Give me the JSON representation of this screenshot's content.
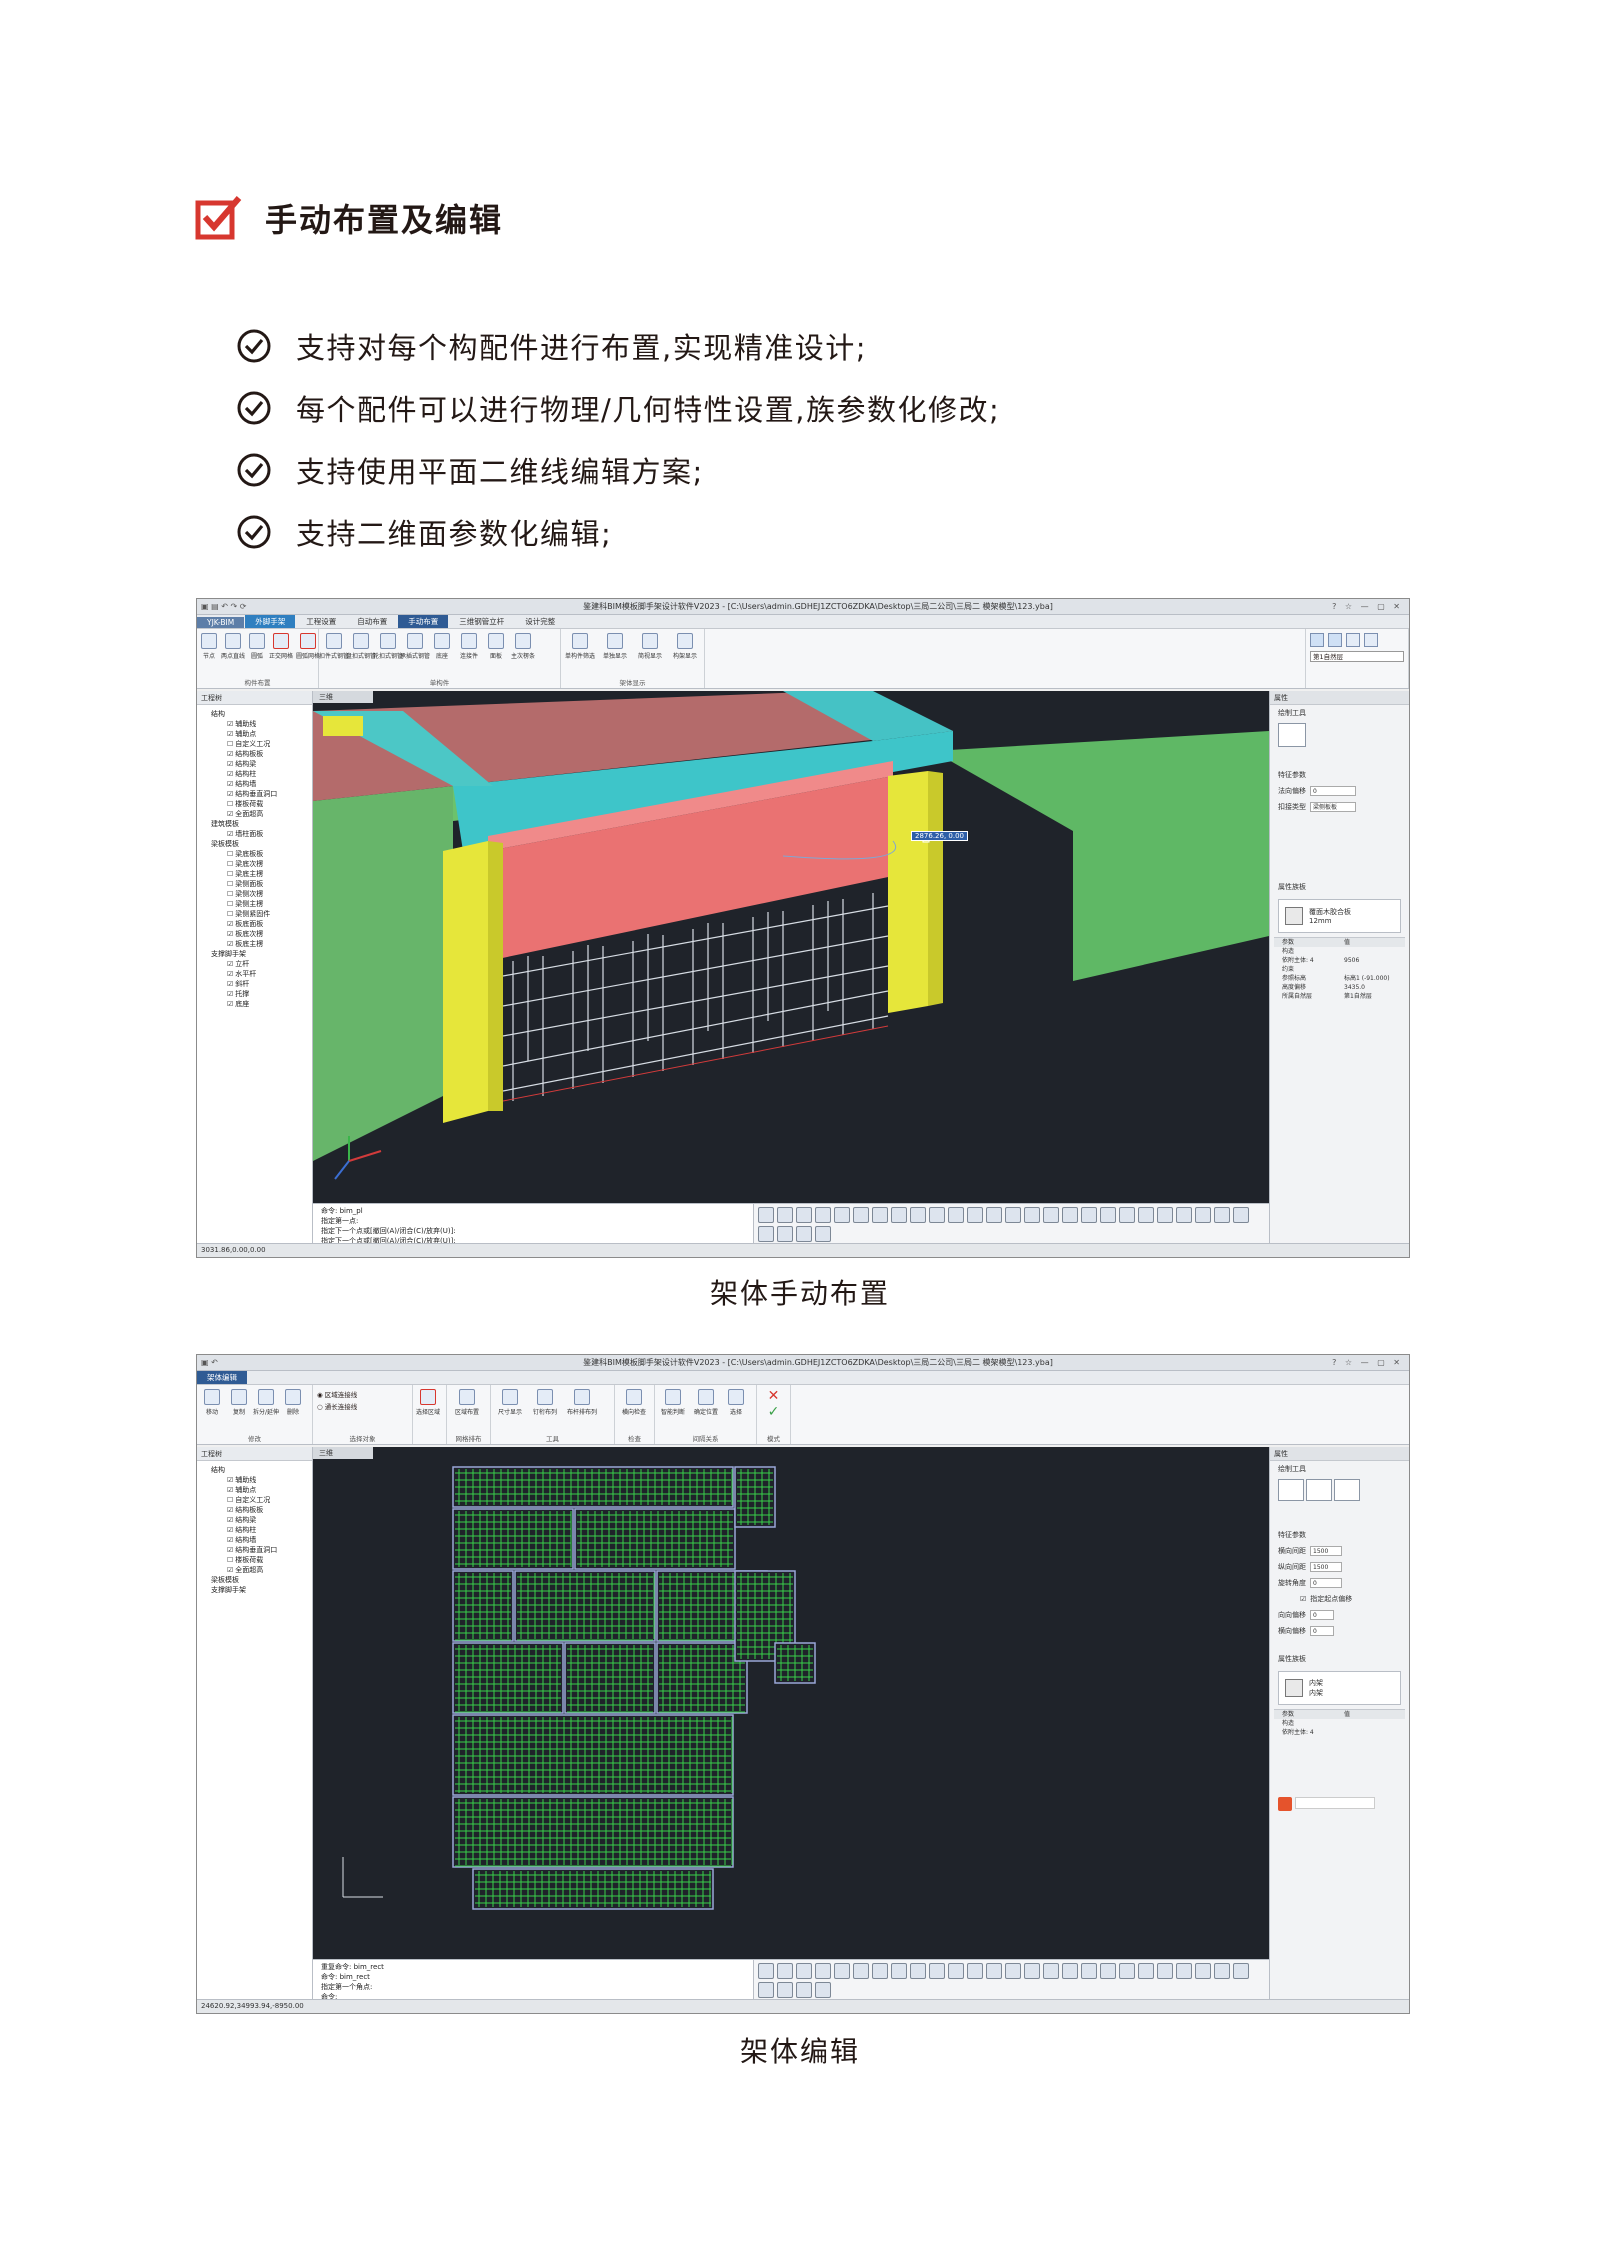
{
  "section": {
    "title": "手动布置及编辑",
    "accent_color": "#d7372f",
    "icon": "checkbox-checked-icon"
  },
  "features": [
    {
      "icon": "check-circle-icon",
      "text": "支持对每个构配件进行布置,实现精准设计;"
    },
    {
      "icon": "check-circle-icon",
      "text": "每个配件可以进行物理/几何特性设置,族参数化修改;"
    },
    {
      "icon": "check-circle-icon",
      "text": "支持使用平面二维线编辑方案;"
    },
    {
      "icon": "check-circle-icon",
      "text": "支持二维面参数化编辑;"
    }
  ],
  "figures": [
    {
      "caption": "架体手动布置",
      "window_title": "鉴建科BIM模板脚手架设计软件V2023 - [C:\\Users\\admin.GDHEJ1ZCTO6ZDKA\\Desktop\\三局二公司\\三局二 模架模型\\123.yba]",
      "tabs": [
        "YJK-BIM",
        "外脚手架",
        "工程设置",
        "自动布置",
        "手动布置",
        "三维钢管立杆",
        "设计完整"
      ],
      "active_tab": "手动布置",
      "ribbon_groups": [
        {
          "name": "构件布置",
          "buttons": [
            "节点",
            "两点直线",
            "圆弧",
            "正交网格",
            "圆弧网格"
          ]
        },
        {
          "name": "单构件",
          "buttons": [
            "扣件式钢管",
            "盘扣式钢管",
            "轮扣式钢管",
            "承插式钢管",
            "底座",
            "连接件",
            "面板",
            "主次楞条"
          ]
        },
        {
          "name": "架体显示",
          "buttons": [
            "单构件筛选",
            "单独显示",
            "简视显示",
            "构架显示"
          ]
        }
      ],
      "floor_select": "第1自然层",
      "left_panel_title": "工程树",
      "tree": [
        {
          "label": "结构",
          "level": 1
        },
        {
          "label": "辅助线",
          "level": 2
        },
        {
          "label": "辅助点",
          "level": 2
        },
        {
          "label": "自定义工况",
          "level": 2,
          "off": true
        },
        {
          "label": "结构板板",
          "level": 2
        },
        {
          "label": "结构梁",
          "level": 2
        },
        {
          "label": "结构柱",
          "level": 2
        },
        {
          "label": "结构墙",
          "level": 2
        },
        {
          "label": "结构垂直洞口",
          "level": 2
        },
        {
          "label": "楼板荷载",
          "level": 2,
          "off": true
        },
        {
          "label": "全面超高",
          "level": 2
        },
        {
          "label": "建筑模板",
          "level": 1
        },
        {
          "label": "墙柱面板",
          "level": 2
        },
        {
          "label": "梁板模板",
          "level": 1
        },
        {
          "label": "梁底板板",
          "level": 2,
          "off": true
        },
        {
          "label": "梁底次楞",
          "level": 2,
          "off": true
        },
        {
          "label": "梁底主楞",
          "level": 2,
          "off": true
        },
        {
          "label": "梁侧面板",
          "level": 2,
          "off": true
        },
        {
          "label": "梁侧次楞",
          "level": 2,
          "off": true
        },
        {
          "label": "梁侧主楞",
          "level": 2,
          "off": true
        },
        {
          "label": "梁侧紧固件",
          "level": 2,
          "off": true
        },
        {
          "label": "板底面板",
          "level": 2
        },
        {
          "label": "板底次楞",
          "level": 2
        },
        {
          "label": "板底主楞",
          "level": 2
        },
        {
          "label": "支撑脚手架",
          "level": 1
        },
        {
          "label": "立杆",
          "level": 2
        },
        {
          "label": "水平杆",
          "level": 2
        },
        {
          "label": "斜杆",
          "level": 2
        },
        {
          "label": "托撑",
          "level": 2
        },
        {
          "label": "底座",
          "level": 2
        }
      ],
      "view_tab": "三维",
      "dim_label": "2876.26, 0.00",
      "properties": {
        "title": "属性",
        "draw_tool": "绘制工具",
        "params_title": "特征参数",
        "fields": [
          {
            "label": "法向偏移",
            "value": "0"
          },
          {
            "label": "扣接类型",
            "value": "梁侧板板"
          }
        ],
        "family_title": "属性族板",
        "family_name": "覆面木胶合板",
        "family_sub": "12mm",
        "table_head": [
          "参数",
          "值"
        ],
        "rows": [
          {
            "k": "构造",
            "v": ""
          },
          {
            "k": "依附主体: 4",
            "v": "9506"
          },
          {
            "k": "约束",
            "v": ""
          },
          {
            "k": "参照标高",
            "v": "标高1 (-91.000)"
          },
          {
            "k": "高度偏移",
            "v": "3435.0"
          },
          {
            "k": "所属自然层",
            "v": "第1自然层"
          }
        ]
      },
      "command_lines": [
        "命令: bim_pl",
        "指定第一点:",
        "指定下一个点或[撤回(A)/闭合(C)/放弃(U)]:",
        "指定下一个点或[撤回(A)/闭合(C)/放弃(U)]:"
      ],
      "status": "3031.86,0.00,0.00"
    },
    {
      "caption": "架体编辑",
      "window_title": "鉴建科BIM模板脚手架设计软件V2023 - [C:\\Users\\admin.GDHEJ1ZCTO6ZDKA\\Desktop\\三局二公司\\三局二 模架模型\\123.yba]",
      "tabs": [
        "架体编辑"
      ],
      "active_tab": "架体编辑",
      "ribbon_groups": [
        {
          "name": "修改",
          "buttons": [
            "移动",
            "复制",
            "拆分/延伸",
            "删除"
          ]
        },
        {
          "name": "选择对象",
          "buttons": [
            "区域连接线",
            "通长连接线",
            "选择区域"
          ]
        },
        {
          "name": "网格排布",
          "buttons": [
            "区域布置"
          ]
        },
        {
          "name": "工具",
          "buttons": [
            "尺寸显示",
            "钉桁布列",
            "布杆排布列"
          ]
        },
        {
          "name": "检查",
          "buttons": [
            "横向检查"
          ]
        },
        {
          "name": "间隔关系",
          "buttons": [
            "智能判断",
            "确定位置",
            "选择"
          ]
        },
        {
          "name": "模式",
          "buttons": [
            "取消",
            "完成"
          ]
        }
      ],
      "left_panel_title": "工程树",
      "tree": [
        {
          "label": "结构",
          "level": 1
        },
        {
          "label": "辅助线",
          "level": 2
        },
        {
          "label": "辅助点",
          "level": 2
        },
        {
          "label": "自定义工况",
          "level": 2,
          "off": true
        },
        {
          "label": "结构板板",
          "level": 2
        },
        {
          "label": "结构梁",
          "level": 2
        },
        {
          "label": "结构柱",
          "level": 2
        },
        {
          "label": "结构墙",
          "level": 2
        },
        {
          "label": "结构垂直洞口",
          "level": 2
        },
        {
          "label": "楼板荷载",
          "level": 2,
          "off": true
        },
        {
          "label": "全面超高",
          "level": 2
        },
        {
          "label": "梁板模板",
          "level": 1
        },
        {
          "label": "支撑脚手架",
          "level": 1
        }
      ],
      "view_tab": "三维",
      "properties": {
        "title": "属性",
        "draw_tool": "绘制工具",
        "params_title": "特征参数",
        "fields": [
          {
            "label": "横向间距",
            "value": "1500"
          },
          {
            "label": "纵向间距",
            "value": "1500"
          },
          {
            "label": "旋转角度",
            "value": "0"
          },
          {
            "label": "指定起点偏移",
            "value": ""
          },
          {
            "label": "向向偏移",
            "value": "0"
          },
          {
            "label": "横向偏移",
            "value": "0"
          }
        ],
        "family_title": "属性族板",
        "family_name": "内架",
        "family_sub": "内架",
        "table_head": [
          "参数",
          "值"
        ],
        "rows": [
          {
            "k": "构造",
            "v": ""
          },
          {
            "k": "依附主体: 4",
            "v": ""
          }
        ]
      },
      "command_lines": [
        "重复命令: bim_rect",
        "命令: bim_rect",
        "指定第一个角点:",
        "命令:"
      ],
      "status": "24620.92,34993.94,-8950.00"
    }
  ]
}
